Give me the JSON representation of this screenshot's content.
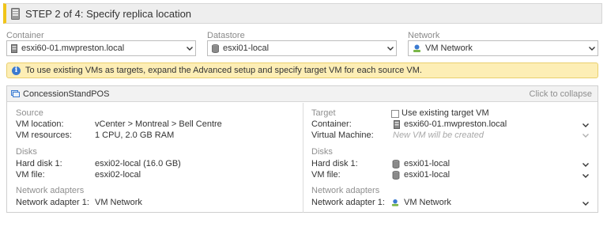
{
  "step": {
    "title": "STEP 2 of 4: Specify replica location"
  },
  "fields": {
    "container": {
      "label": "Container",
      "value": "esxi60-01.mwpreston.local",
      "icon": "server-icon"
    },
    "datastore": {
      "label": "Datastore",
      "value": "esxi01-local",
      "icon": "datastore-icon"
    },
    "network": {
      "label": "Network",
      "value": "VM Network",
      "icon": "network-icon"
    }
  },
  "info": {
    "message": "To use existing VMs as targets, expand the Advanced setup and specify target VM for each source VM."
  },
  "vm_panel": {
    "name": "ConcessionStandPOS",
    "collapse_label": "Click to collapse",
    "source": {
      "heading": "Source",
      "vm_location_label": "VM location:",
      "vm_location": "vCenter > Montreal > Bell Centre",
      "vm_resources_label": "VM resources:",
      "vm_resources": "1 CPU, 2.0 GB RAM",
      "disks_heading": "Disks",
      "hard_disk_label": "Hard disk 1:",
      "hard_disk": "esxi02-local (16.0 GB)",
      "vm_file_label": "VM file:",
      "vm_file": "esxi02-local",
      "network_heading": "Network adapters",
      "adapter_label": "Network adapter 1:",
      "adapter": "VM Network"
    },
    "target": {
      "heading": "Target",
      "use_existing_label": "Use existing target VM",
      "use_existing_checked": false,
      "container_label": "Container:",
      "container": "esxi60-01.mwpreston.local",
      "vm_label": "Virtual Machine:",
      "vm_placeholder": "New VM will be created",
      "disks_heading": "Disks",
      "hard_disk_label": "Hard disk 1:",
      "hard_disk": "esxi01-local",
      "vm_file_label": "VM file:",
      "vm_file": "esxi01-local",
      "network_heading": "Network adapters",
      "adapter_label": "Network adapter 1:",
      "adapter": "VM Network"
    }
  },
  "colors": {
    "accent": "#f0c419",
    "info_bg": "#fdeeb5",
    "info_icon": "#3b7ad0",
    "muted": "#8f8f8f"
  }
}
